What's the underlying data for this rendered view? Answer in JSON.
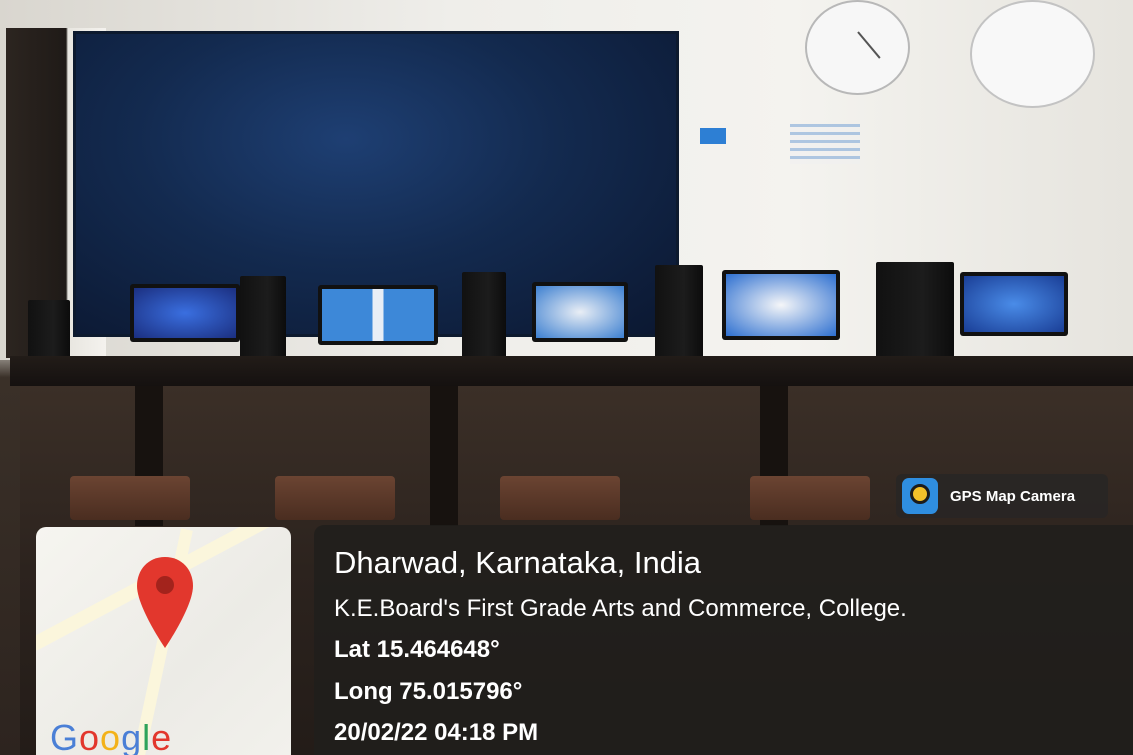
{
  "overlay": {
    "app_badge": "GPS Map Camera",
    "location": "Dharwad, Karnataka, India",
    "address": "K.E.Board's First Grade Arts and Commerce, College.",
    "latitude": "Lat 15.464648°",
    "longitude": "Long 75.015796°",
    "timestamp": "20/02/22 04:18 PM"
  },
  "map": {
    "logo_text": "Google",
    "pin_icon": "map-pin-icon"
  },
  "colors": {
    "pin": "#e2372d",
    "badge_icon": "#2f8ee0",
    "overlay_bg": "#201e1c"
  }
}
